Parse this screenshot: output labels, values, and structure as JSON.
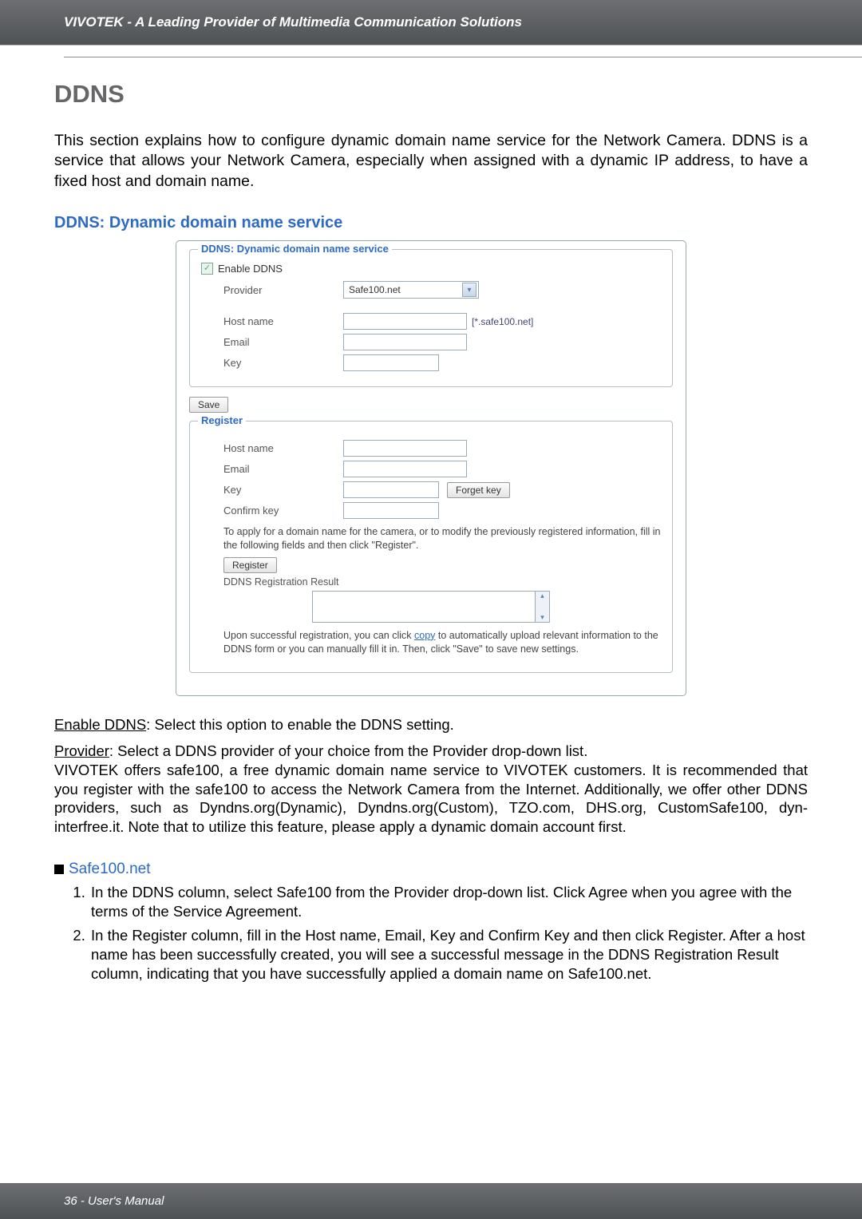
{
  "header": {
    "text": "VIVOTEK - A Leading Provider of Multimedia Communication Solutions"
  },
  "section": {
    "title": "DDNS",
    "intro": "This section explains how to configure dynamic domain name service for the Network Camera. DDNS is a service that allows your Network Camera, especially when assigned with a dynamic IP address, to have a fixed host and domain name.",
    "subhead": "DDNS: Dynamic domain name service"
  },
  "panel": {
    "fs1_legend": "DDNS: Dynamic domain name service",
    "enable_label": "Enable DDNS",
    "provider_label": "Provider",
    "provider_value": "Safe100.net",
    "hostname_label": "Host name",
    "host_suffix": "[*.safe100.net]",
    "email_label": "Email",
    "key_label": "Key",
    "save_btn": "Save",
    "fs2_legend": "Register",
    "reg_hostname_label": "Host name",
    "reg_email_label": "Email",
    "reg_key_label": "Key",
    "forget_key_btn": "Forget key",
    "confirm_key_label": "Confirm key",
    "apply_text": "To apply for a domain name for the camera, or to modify the previously registered information, fill in the following fields and then click \"Register\".",
    "register_btn": "Register",
    "result_label": "DDNS Registration Result",
    "success_prefix": "Upon successful registration, you can click ",
    "copy_link": "copy",
    "success_suffix": " to automatically upload relevant information to the DDNS form or you can manually fill it in. Then, click \"Save\" to save new settings."
  },
  "explain": {
    "enable_label": "Enable DDNS",
    "enable_text": ": Select this option to enable the DDNS setting.",
    "provider_label": "Provider",
    "provider_text1": ": Select a DDNS provider of your choice from the Provider drop-down list.",
    "provider_text2": "VIVOTEK offers safe100, a free dynamic domain name service to VIVOTEK customers. It is recommended that you register with the safe100 to access the Network Camera from the Internet. Additionally, we offer other DDNS providers, such as Dyndns.org(Dynamic), Dyndns.org(Custom), TZO.com, DHS.org, CustomSafe100, dyn-interfree.it. Note that to utilize this feature, please apply a dynamic domain account first."
  },
  "safe100": {
    "heading": "Safe100.net",
    "step1": "In the DDNS column, select Safe100 from the Provider drop-down list. Click Agree when you agree with the terms of the Service Agreement.",
    "step2": "In the Register column, fill in the Host name, Email, Key and Confirm Key and then click Register. After a host name has been successfully created, you will see a successful message in the DDNS Registration Result column, indicating that you have successfully applied a domain name on Safe100.net."
  },
  "footer": {
    "text": "36 - User's Manual"
  }
}
